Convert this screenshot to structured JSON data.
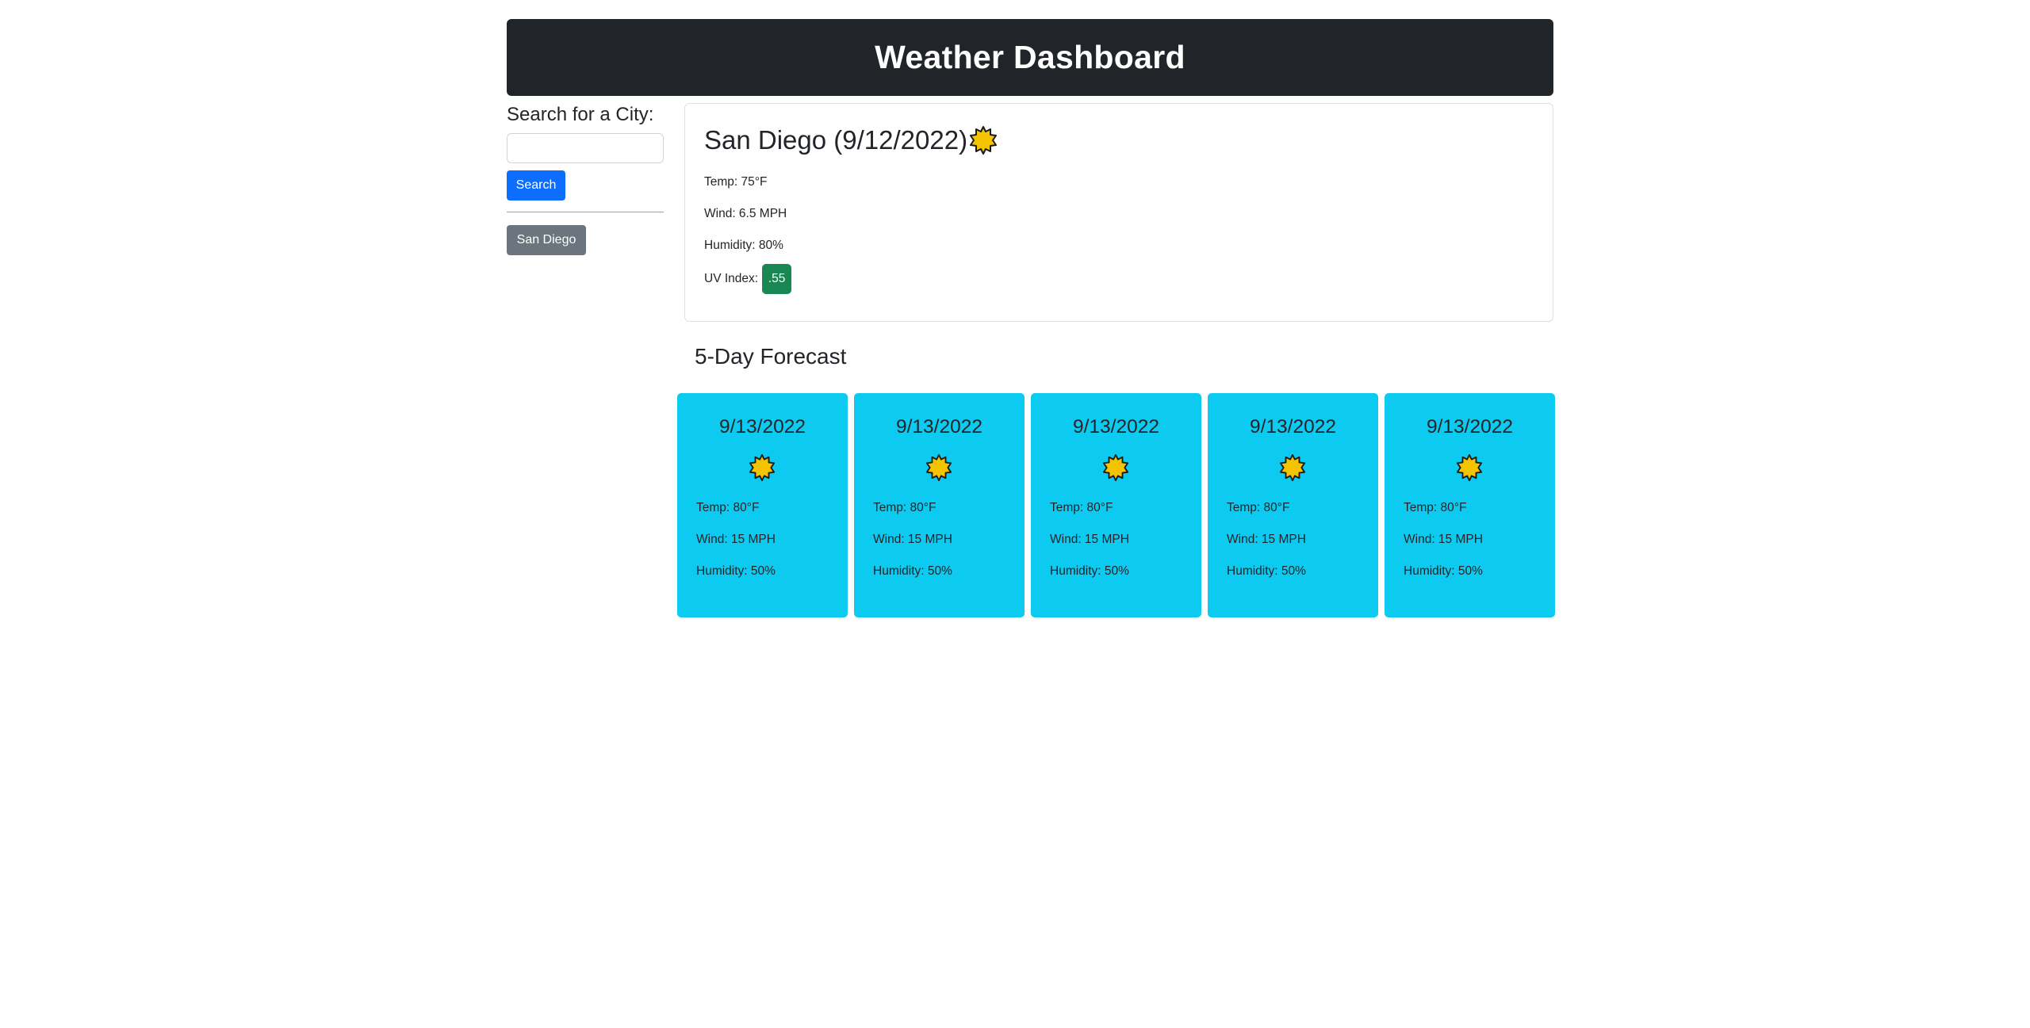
{
  "header": {
    "title": "Weather Dashboard"
  },
  "sidebar": {
    "search_label": "Search for a City:",
    "search_value": "",
    "search_button": "Search",
    "history": [
      "San Diego"
    ]
  },
  "current": {
    "city_date": "San Diego (9/12/2022)",
    "icon": "sun-icon",
    "temp": "Temp: 75°F",
    "wind": "Wind: 6.5 MPH",
    "humidity": "Humidity: 80%",
    "uv_label": "UV Index:",
    "uv_value": ".55",
    "uv_color": "#198754"
  },
  "forecast": {
    "title": "5-Day Forecast",
    "card_color": "#0dcaf0",
    "days": [
      {
        "date": "9/13/2022",
        "icon": "sun-icon",
        "temp": "Temp: 80°F",
        "wind": "Wind: 15 MPH",
        "humidity": "Humidity: 50%"
      },
      {
        "date": "9/13/2022",
        "icon": "sun-icon",
        "temp": "Temp: 80°F",
        "wind": "Wind: 15 MPH",
        "humidity": "Humidity: 50%"
      },
      {
        "date": "9/13/2022",
        "icon": "sun-icon",
        "temp": "Temp: 80°F",
        "wind": "Wind: 15 MPH",
        "humidity": "Humidity: 50%"
      },
      {
        "date": "9/13/2022",
        "icon": "sun-icon",
        "temp": "Temp: 80°F",
        "wind": "Wind: 15 MPH",
        "humidity": "Humidity: 50%"
      },
      {
        "date": "9/13/2022",
        "icon": "sun-icon",
        "temp": "Temp: 80°F",
        "wind": "Wind: 15 MPH",
        "humidity": "Humidity: 50%"
      }
    ]
  }
}
